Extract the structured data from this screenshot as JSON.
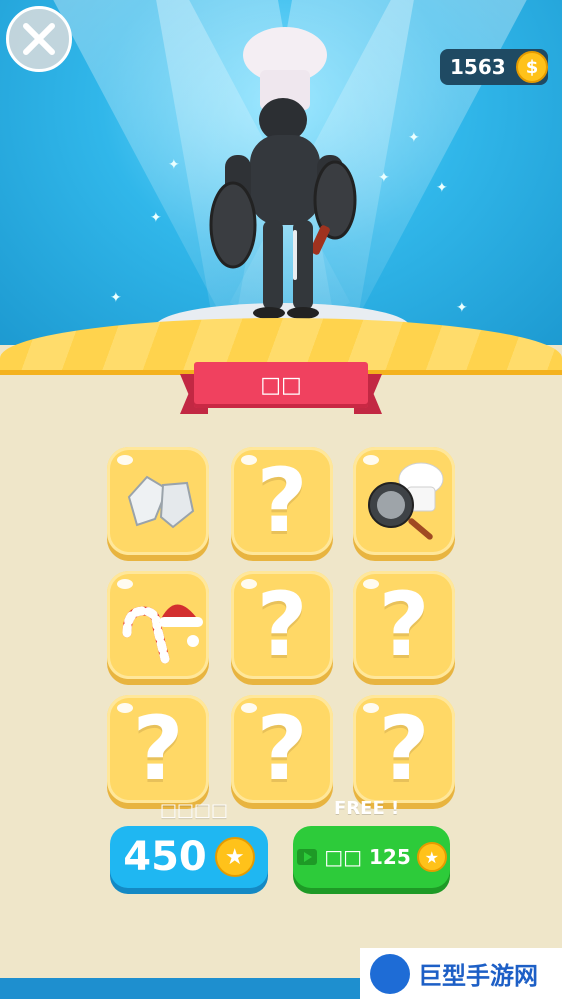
{
  "header": {
    "coins": "1563",
    "coin_glyph": "$"
  },
  "ribbon": {
    "title": "□□"
  },
  "grid": {
    "items": [
      {
        "type": "item",
        "icon": "gloves-icon"
      },
      {
        "type": "locked",
        "label": "?"
      },
      {
        "type": "item",
        "icon": "chef-hat-pan-icon"
      },
      {
        "type": "item",
        "icon": "candy-cane-santa-hat-icon"
      },
      {
        "type": "locked",
        "label": "?"
      },
      {
        "type": "locked",
        "label": "?"
      },
      {
        "type": "locked",
        "label": "?"
      },
      {
        "type": "locked",
        "label": "?"
      },
      {
        "type": "locked",
        "label": "?"
      }
    ]
  },
  "actions": {
    "buy_caption": "□□□□",
    "buy_price": "450",
    "free_caption": "FREE !",
    "ad_label": "□□ 125"
  },
  "watermark": {
    "text": "巨型手游网"
  },
  "colors": {
    "sky": "#31b7ea",
    "ribbon": "#f0415f",
    "cell": "#ffd866",
    "buy_button": "#1fb7f2",
    "ad_button": "#2dcb3a"
  }
}
